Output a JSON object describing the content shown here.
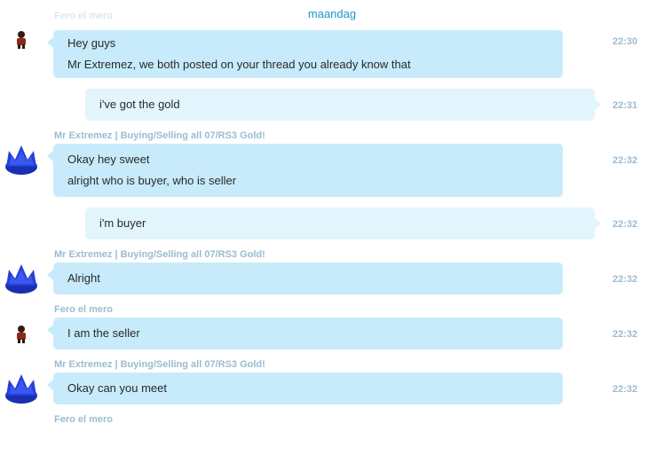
{
  "date_header": "maandag",
  "ghost_sender": "Fero el mero",
  "messages": [
    {
      "sender": "",
      "lines": [
        "Hey guys",
        "Mr Extremez, we both posted on your thread you already know that"
      ],
      "time": "22:30"
    },
    {
      "sender": "",
      "lines": [
        "i've got the gold"
      ],
      "time": "22:31"
    },
    {
      "sender": "Mr Extremez | Buying/Selling all 07/RS3 Gold!",
      "lines": [
        "Okay hey sweet",
        "alright who is buyer, who is seller"
      ],
      "time": "22:32"
    },
    {
      "sender": "",
      "lines": [
        "i'm buyer"
      ],
      "time": "22:32"
    },
    {
      "sender": "Mr Extremez | Buying/Selling all 07/RS3 Gold!",
      "lines": [
        "Alright"
      ],
      "time": "22:32"
    },
    {
      "sender": "Fero el mero",
      "lines": [
        "I am the seller"
      ],
      "time": "22:32"
    },
    {
      "sender": "Mr Extremez | Buying/Selling all 07/RS3 Gold!",
      "lines": [
        "Okay can you meet"
      ],
      "time": "22:32"
    },
    {
      "sender": "Fero el mero",
      "lines": [],
      "time": ""
    }
  ],
  "icons": {
    "fero_avatar": "person-avatar-icon",
    "extremez_avatar": "blue-crown-avatar-icon"
  },
  "colors": {
    "incoming_bubble": "#c7ebfb",
    "outgoing_bubble": "#e2f5fc",
    "meta_text": "#9bbcd0",
    "date_header": "#1e95c8"
  }
}
